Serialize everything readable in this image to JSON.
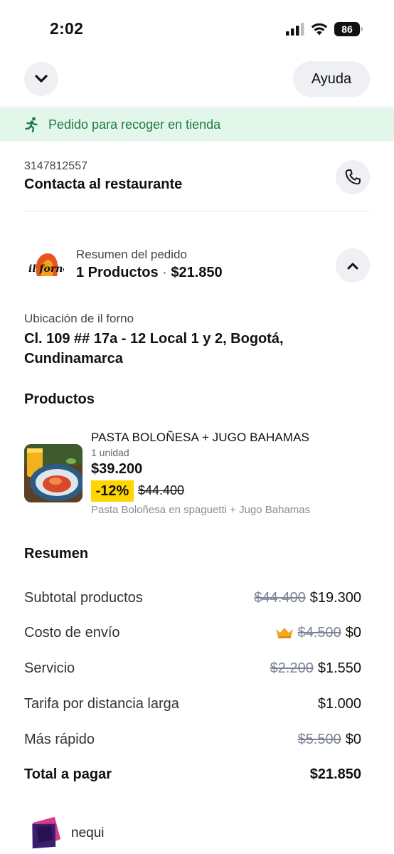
{
  "status_bar": {
    "time": "2:02",
    "battery": "86"
  },
  "header": {
    "help_label": "Ayuda"
  },
  "pickup_banner": {
    "text": "Pedido para recoger en tienda"
  },
  "contact": {
    "phone": "3147812557",
    "title": "Contacta al restaurante"
  },
  "order_summary": {
    "label": "Resumen del pedido",
    "products_count": "1 Productos",
    "separator": "·",
    "total": "$21.850",
    "store_logo_text": "il forno"
  },
  "location": {
    "label": "Ubicación de il forno",
    "address": "Cl. 109 ## 17a - 12 Local 1 y 2, Bogotá, Cundinamarca"
  },
  "products": {
    "heading": "Productos",
    "items": [
      {
        "name": "PASTA BOLOÑESA + JUGO BAHAMAS",
        "quantity": "1 unidad",
        "price": "$39.200",
        "discount": "-12%",
        "old_price": "$44.400",
        "description": "Pasta Boloñesa en spaguetti + Jugo Bahamas"
      }
    ]
  },
  "resumen": {
    "heading": "Resumen",
    "rows": [
      {
        "label": "Subtotal productos",
        "old": "$44.400",
        "value": "$19.300"
      },
      {
        "label": "Costo de envío",
        "old": "$4.500",
        "value": "$0",
        "icon": "crown-icon"
      },
      {
        "label": "Servicio",
        "old": "$2.200",
        "value": "$1.550"
      },
      {
        "label": "Tarifa por distancia larga",
        "value": "$1.000"
      },
      {
        "label": "Más rápido",
        "old": "$5.500",
        "value": "$0"
      }
    ],
    "total": {
      "label": "Total a pagar",
      "value": "$21.850"
    }
  },
  "payment": {
    "method": "nequi"
  },
  "colors": {
    "banner_bg": "#e3f6ea",
    "banner_text": "#1f7a45",
    "discount_bg": "#ffd600",
    "button_bg": "#eef0f4",
    "strike_text": "#7d8396"
  }
}
